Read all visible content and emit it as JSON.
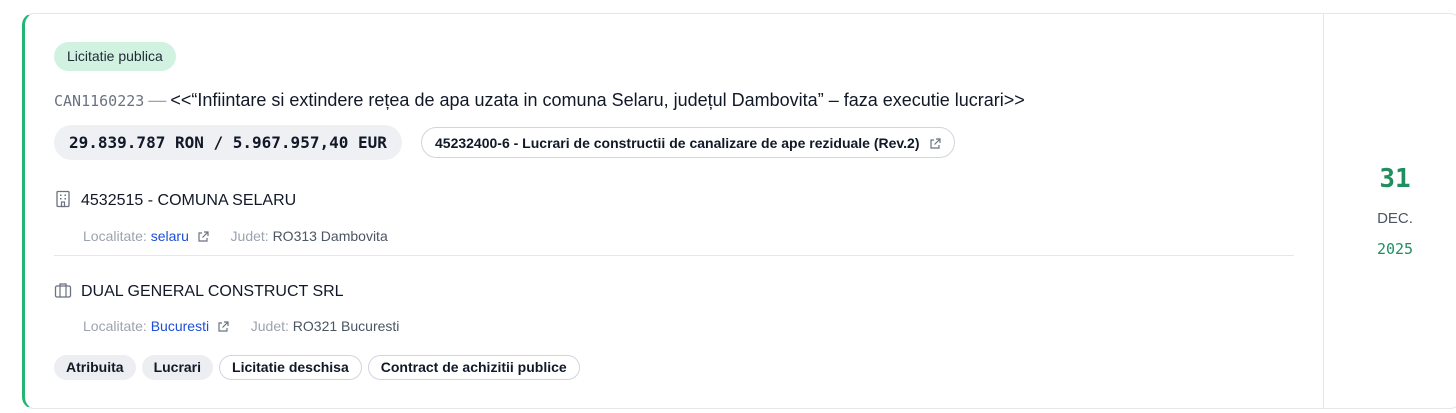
{
  "procedure": {
    "type_badge": "Licitatie publica",
    "code": "CAN1160223",
    "separator": "—",
    "title": "<<“Infiintare si extindere rețea de apa uzata in comuna Selaru, județul Dambovita” – faza executie lucrari>>"
  },
  "value": {
    "text": "29.839.787 RON / 5.967.957,40 EUR"
  },
  "cpv": {
    "text": "45232400-6 - Lucrari de constructii de canalizare de ape reziduale (Rev.2)",
    "icon": "external-link-icon"
  },
  "authority": {
    "icon": "building-icon",
    "name": "4532515 - COMUNA SELARU",
    "locality_label": "Localitate:",
    "locality": "selaru",
    "county_label": "Judet:",
    "county": "RO313 Dambovita"
  },
  "supplier": {
    "icon": "briefcase-icon",
    "name": "DUAL GENERAL CONSTRUCT SRL",
    "locality_label": "Localitate:",
    "locality": "Bucuresti",
    "county_label": "Judet:",
    "county": "RO321 Bucuresti"
  },
  "tags": [
    "Atribuita",
    "Lucrari",
    "Licitatie deschisa",
    "Contract de achizitii publice"
  ],
  "date": {
    "day": "31",
    "month": "DEC.",
    "year": "2025"
  },
  "colors": {
    "accent": "#22b573",
    "badge_bg": "#d1f2e1",
    "date_green": "#1f8f5f",
    "link_blue": "#1d4ed8"
  }
}
